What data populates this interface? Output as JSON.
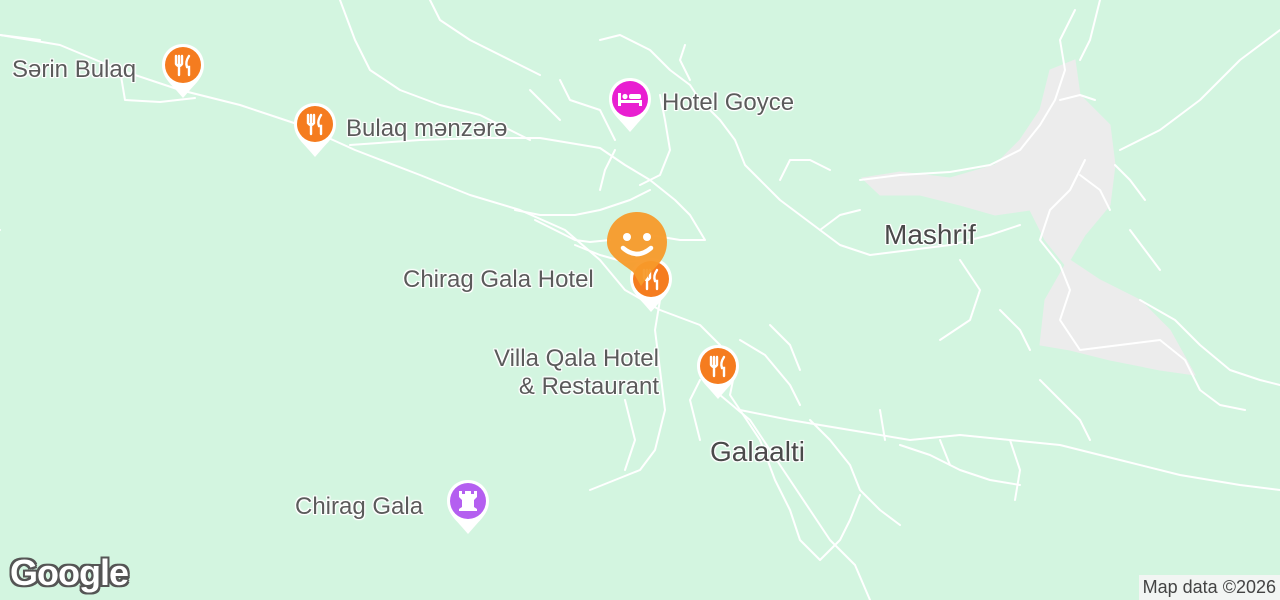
{
  "map": {
    "pois": [
      {
        "name": "Sərin Bulaq",
        "category": "restaurant",
        "icon": "fork-knife-icon",
        "color": "#f57c1f"
      },
      {
        "name": "Bulaq mənzərə",
        "category": "restaurant",
        "icon": "fork-knife-icon",
        "color": "#f57c1f"
      },
      {
        "name": "Hotel Goyce",
        "category": "hotel",
        "icon": "bed-icon",
        "color": "#e91ed1"
      },
      {
        "name": "Chirag Gala Hotel",
        "category": "restaurant",
        "icon": "fork-knife-icon",
        "color": "#f57c1f"
      },
      {
        "name_line1": "Villa Qala Hotel",
        "name_line2": "& Restaurant",
        "category": "restaurant",
        "icon": "fork-knife-icon",
        "color": "#f57c1f"
      },
      {
        "name": "Chirag Gala",
        "category": "landmark",
        "icon": "castle-tower-icon",
        "color": "#b45ff0"
      }
    ],
    "places": [
      {
        "name": "Mashrif"
      },
      {
        "name": "Galaalti"
      }
    ],
    "current_marker": {
      "icon": "smiley-icon",
      "color": "#f79a2a"
    },
    "colors": {
      "background": "#d3f5e0",
      "road": "#ffffff",
      "urban": "#ececec"
    },
    "logo": "Google",
    "attribution": "Map data ©2026"
  }
}
